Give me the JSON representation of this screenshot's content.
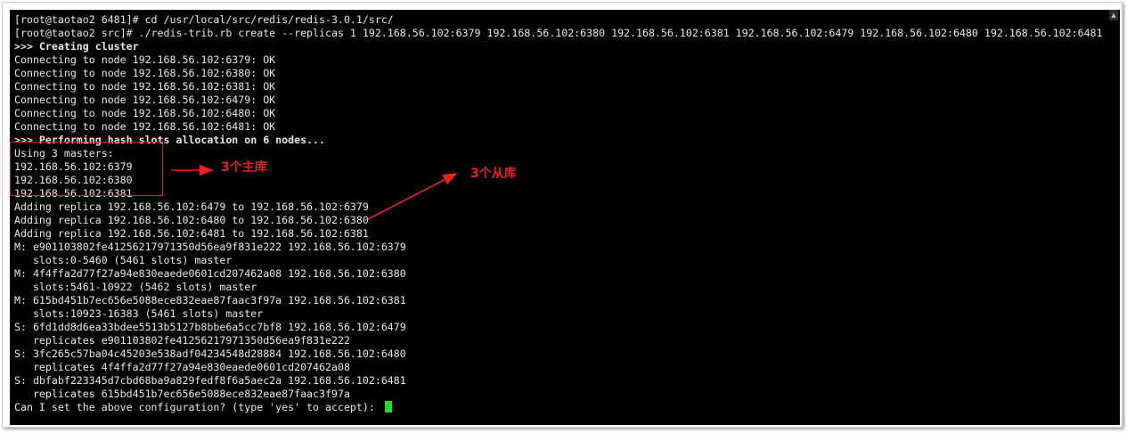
{
  "terminal": {
    "lines": [
      {
        "text": "[root@taotao2 6481]# cd /usr/local/src/redis/redis-3.0.1/src/",
        "bold": false
      },
      {
        "text": "[root@taotao2 src]# ./redis-trib.rb create --replicas 1 192.168.56.102:6379 192.168.56.102:6380 192.168.56.102:6381 192.168.56.102:6479 192.168.56.102:6480 192.168.56.102:6481",
        "bold": false
      },
      {
        "text": ">>> Creating cluster",
        "bold": true
      },
      {
        "text": "Connecting to node 192.168.56.102:6379: OK",
        "bold": false
      },
      {
        "text": "Connecting to node 192.168.56.102:6380: OK",
        "bold": false
      },
      {
        "text": "Connecting to node 192.168.56.102:6381: OK",
        "bold": false
      },
      {
        "text": "Connecting to node 192.168.56.102:6479: OK",
        "bold": false
      },
      {
        "text": "Connecting to node 192.168.56.102:6480: OK",
        "bold": false
      },
      {
        "text": "Connecting to node 192.168.56.102:6481: OK",
        "bold": false
      },
      {
        "text": ">>> Performing hash slots allocation on 6 nodes...",
        "bold": true
      },
      {
        "text": "Using 3 masters:",
        "bold": false
      },
      {
        "text": "192.168.56.102:6379",
        "bold": false
      },
      {
        "text": "192.168.56.102:6380",
        "bold": false
      },
      {
        "text": "192.168.56.102:6381",
        "bold": false
      },
      {
        "text": "Adding replica 192.168.56.102:6479 to 192.168.56.102:6379",
        "bold": false
      },
      {
        "text": "Adding replica 192.168.56.102:6480 to 192.168.56.102:6380",
        "bold": false
      },
      {
        "text": "Adding replica 192.168.56.102:6481 to 192.168.56.102:6381",
        "bold": false
      },
      {
        "text": "M: e901103802fe41256217971350d56ea9f831e222 192.168.56.102:6379",
        "bold": false
      },
      {
        "text": "   slots:0-5460 (5461 slots) master",
        "bold": false
      },
      {
        "text": "M: 4f4ffa2d77f27a94e830eaede0601cd207462a08 192.168.56.102:6380",
        "bold": false
      },
      {
        "text": "   slots:5461-10922 (5462 slots) master",
        "bold": false
      },
      {
        "text": "M: 615bd451b7ec656e5088ece832eae87faac3f97a 192.168.56.102:6381",
        "bold": false
      },
      {
        "text": "   slots:10923-16383 (5461 slots) master",
        "bold": false
      },
      {
        "text": "S: 6fd1dd8d6ea33bdee5513b5127b8bbe6a5cc7bf8 192.168.56.102:6479",
        "bold": false
      },
      {
        "text": "   replicates e901103802fe41256217971350d56ea9f831e222",
        "bold": false
      },
      {
        "text": "S: 3fc265c57ba04c45203e538adf04234548d28884 192.168.56.102:6480",
        "bold": false
      },
      {
        "text": "   replicates 4f4ffa2d77f27a94e830eaede0601cd207462a08",
        "bold": false
      },
      {
        "text": "S: dbfabf223345d7cbd68ba9a829fedf8f6a5aec2a 192.168.56.102:6481",
        "bold": false
      },
      {
        "text": "   replicates 615bd451b7ec656e5088ece832eae87faac3f97a",
        "bold": false
      }
    ],
    "prompt": "Can I set the above configuration? (type 'yes' to accept): "
  },
  "annotations": {
    "masters_label": "3个主库",
    "slaves_label": "3个从库"
  },
  "colors": {
    "terminal_bg": "#000000",
    "terminal_fg": "#e8e8e8",
    "cursor": "#19e619",
    "annotation": "#e82020"
  },
  "icons": {
    "scroll_up": "scroll-up-arrow-icon"
  }
}
